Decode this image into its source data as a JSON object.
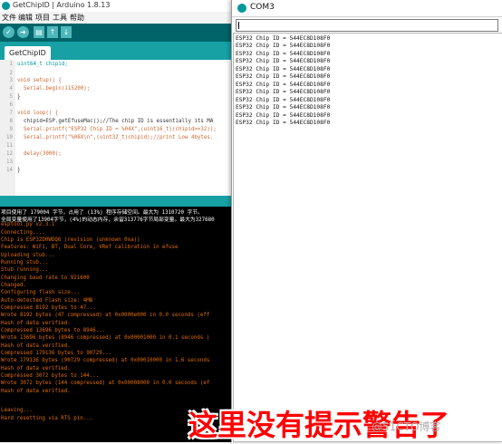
{
  "ide": {
    "title": "GetChipID | Arduino 1.8.13",
    "menu": [
      "文件",
      "编辑",
      "项目",
      "工具",
      "帮助"
    ],
    "tab_label": "GetChipID",
    "code_lines": [
      {
        "n": "1",
        "text": "uint64_t chipid;"
      },
      {
        "n": "2",
        "text": ""
      },
      {
        "n": "3",
        "text": "void setup() {"
      },
      {
        "n": "4",
        "text": "  Serial.begin(115200);"
      },
      {
        "n": "5",
        "text": "}"
      },
      {
        "n": "6",
        "text": ""
      },
      {
        "n": "7",
        "text": "void loop() {"
      },
      {
        "n": "8",
        "text": "  chipid=ESP.getEfuseMac();//The chip ID is essentially its MA"
      },
      {
        "n": "9",
        "text": "  Serial.printf(\"ESP32 Chip ID = %04X\",(uint16_t)(chipid>>32));"
      },
      {
        "n": "10",
        "text": "  Serial.printf(\"%08X\\n\",(uint32_t)chipid);//print Low 4bytes."
      },
      {
        "n": "11",
        "text": ""
      },
      {
        "n": "12",
        "text": "  delay(3000);"
      },
      {
        "n": "13",
        "text": ""
      },
      {
        "n": "14",
        "text": "}"
      }
    ],
    "console_lines": [
      {
        "text": "项目使用了 179004 字节，占用了 (13%) 程序存储空间。最大为 1310720 字节。",
        "c": "w"
      },
      {
        "text": "全局变量使用了13904字节，(4%)的动态内存，余留313776字节局部变量。最大为327680",
        "c": "w"
      },
      {
        "text": "esptool.py v2.3.1",
        "c": "o"
      },
      {
        "text": "Connecting....",
        "c": "o"
      },
      {
        "text": "Chip is ESP32D0WDQ6 (revision (unknown 0xa))",
        "c": "o"
      },
      {
        "text": "Features: WiFi, BT, Dual Core, VRef calibration in efuse",
        "c": "o"
      },
      {
        "text": "Uploading stub...",
        "c": "o"
      },
      {
        "text": "Running stub...",
        "c": "o"
      },
      {
        "text": "Stub running...",
        "c": "o"
      },
      {
        "text": "Changing baud rate to 921600",
        "c": "o"
      },
      {
        "text": "Changed.",
        "c": "o"
      },
      {
        "text": "Configuring flash size...",
        "c": "o"
      },
      {
        "text": "Auto-detected Flash size: 4MB",
        "c": "o"
      },
      {
        "text": "Compressed 8192 bytes to 47...",
        "c": "o"
      },
      {
        "text": "Wrote 8192 bytes (47 compressed) at 0x0000e000 in 0.0 seconds (eff",
        "c": "o"
      },
      {
        "text": "Hash of data verified.",
        "c": "o"
      },
      {
        "text": "Compressed 13696 bytes to 8946...",
        "c": "o"
      },
      {
        "text": "Wrote 13696 bytes (8946 compressed) at 0x00001000 in 0.1 seconds (",
        "c": "o"
      },
      {
        "text": "Hash of data verified.",
        "c": "o"
      },
      {
        "text": "Compressed 179136 bytes to 90729...",
        "c": "o"
      },
      {
        "text": "Wrote 179136 bytes (90729 compressed) at 0x00010000 in 1.6 seconds",
        "c": "o"
      },
      {
        "text": "Hash of data verified.",
        "c": "o"
      },
      {
        "text": "Compressed 3072 bytes to 144...",
        "c": "o"
      },
      {
        "text": "Wrote 3072 bytes (144 compressed) at 0x00008000 in 0.0 seconds (ef",
        "c": "o"
      },
      {
        "text": "Hash of data verified.",
        "c": "o"
      },
      {
        "text": "",
        "c": "o"
      },
      {
        "text": "Leaving...",
        "c": "o"
      },
      {
        "text": "Hard resetting via RTS pin...",
        "c": "o"
      }
    ]
  },
  "serial": {
    "title": "COM3",
    "input_value": "",
    "lines": [
      "ESP32 Chip ID = 544EC8D108F0",
      "ESP32 Chip ID = 544EC8D108F0",
      "ESP32 Chip ID = 544EC8D108F0",
      "ESP32 Chip ID = 544EC8D108F0",
      "ESP32 Chip ID = 544EC8D108F0",
      "ESP32 Chip ID = 544EC8D108F0",
      "ESP32 Chip ID = 544EC8D108F0",
      "ESP32 Chip ID = 544EC8D108F0",
      "ESP32 Chip ID = 544EC8D108F0",
      "ESP32 Chip ID = 544EC8D108F0",
      "ESP32 Chip ID = 544EC8D108F0",
      "ESP32 Chip ID = 544EC8D108F0"
    ]
  },
  "caption": "这里没有提示警告了",
  "watermark": "@51CTO博客"
}
